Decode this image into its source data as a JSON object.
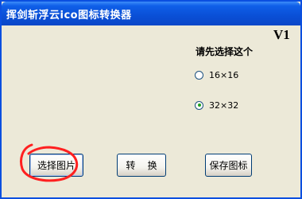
{
  "window": {
    "title": "挥剑斩浮云ico图标转换器"
  },
  "header": {
    "version": "V1"
  },
  "options": {
    "prompt": "请先选择这个",
    "radios": [
      {
        "label": "16×16",
        "checked": false
      },
      {
        "label": "32×32",
        "checked": true
      }
    ]
  },
  "buttons": {
    "select_image": "选择图片",
    "convert": "转    换",
    "save_icon": "保存图标"
  },
  "colors": {
    "titlebar": "#0a4fd6",
    "annotation": "#ff2020"
  }
}
